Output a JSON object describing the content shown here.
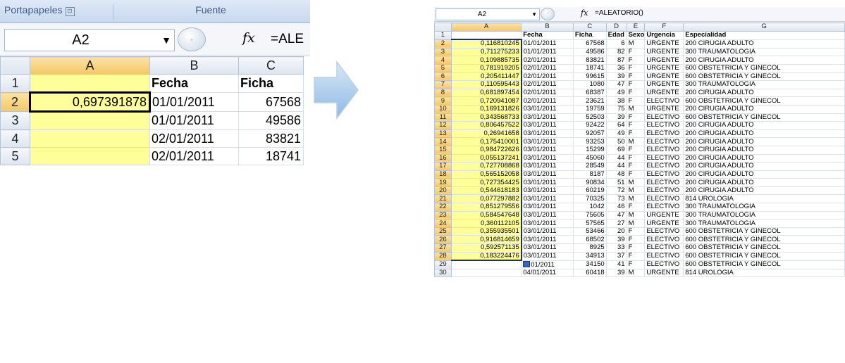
{
  "left": {
    "ribbon": {
      "group1": "Portapapeles",
      "group2": "Fuente",
      "launcher": "⊡"
    },
    "name_box": "A2",
    "formula_display": "=ALE",
    "fx": "fx",
    "columns": [
      "A",
      "B",
      "C"
    ],
    "rows": [
      {
        "num": "1",
        "a": "",
        "b": "Fecha",
        "c": "Ficha"
      },
      {
        "num": "2",
        "a": "0,697391878",
        "b": "01/01/2011",
        "c": "67568"
      },
      {
        "num": "3",
        "a": "",
        "b": "01/01/2011",
        "c": "49586"
      },
      {
        "num": "4",
        "a": "",
        "b": "02/01/2011",
        "c": "83821"
      },
      {
        "num": "5",
        "a": "",
        "b": "02/01/2011",
        "c": "18741"
      }
    ]
  },
  "right": {
    "name_box": "A2",
    "formula": "=ALEATORIO()",
    "fx": "fx",
    "columns": [
      "A",
      "B",
      "C",
      "D",
      "E",
      "F",
      "G"
    ],
    "header_row": {
      "num": "1",
      "a": "",
      "fecha": "Fecha",
      "ficha": "Ficha",
      "edad": "Edad",
      "sexo": "Sexo",
      "urgencia": "Urgencia",
      "especialidad": "Especialidad"
    },
    "rows": [
      {
        "num": "2",
        "a": "0,116810245",
        "fecha": "01/01/2011",
        "ficha": "67568",
        "edad": "6",
        "sexo": "M",
        "urgencia": "URGENTE",
        "especialidad": "200 CIRUGIA ADULTO"
      },
      {
        "num": "3",
        "a": "0,711275233",
        "fecha": "01/01/2011",
        "ficha": "49586",
        "edad": "82",
        "sexo": "F",
        "urgencia": "URGENTE",
        "especialidad": "300 TRAUMATOLOGIA"
      },
      {
        "num": "4",
        "a": "0,109885735",
        "fecha": "02/01/2011",
        "ficha": "83821",
        "edad": "87",
        "sexo": "F",
        "urgencia": "URGENTE",
        "especialidad": "200 CIRUGIA ADULTO"
      },
      {
        "num": "5",
        "a": "0,781919205",
        "fecha": "02/01/2011",
        "ficha": "18741",
        "edad": "36",
        "sexo": "F",
        "urgencia": "URGENTE",
        "especialidad": "600 OBSTETRICIA Y GINECOL"
      },
      {
        "num": "6",
        "a": "0,205411447",
        "fecha": "02/01/2011",
        "ficha": "99615",
        "edad": "39",
        "sexo": "F",
        "urgencia": "URGENTE",
        "especialidad": "600 OBSTETRICIA Y GINECOL"
      },
      {
        "num": "7",
        "a": "0,110595443",
        "fecha": "02/01/2011",
        "ficha": "1080",
        "edad": "47",
        "sexo": "F",
        "urgencia": "URGENTE",
        "especialidad": "300 TRAUMATOLOGIA"
      },
      {
        "num": "8",
        "a": "0,681897454",
        "fecha": "02/01/2011",
        "ficha": "68387",
        "edad": "49",
        "sexo": "F",
        "urgencia": "URGENTE",
        "especialidad": "200 CIRUGIA ADULTO"
      },
      {
        "num": "9",
        "a": "0,720941087",
        "fecha": "02/01/2011",
        "ficha": "23621",
        "edad": "38",
        "sexo": "F",
        "urgencia": "ELECTIVO",
        "especialidad": "600 OBSTETRICIA Y GINECOL"
      },
      {
        "num": "10",
        "a": "0,169131826",
        "fecha": "03/01/2011",
        "ficha": "19759",
        "edad": "75",
        "sexo": "M",
        "urgencia": "URGENTE",
        "especialidad": "200 CIRUGIA ADULTO"
      },
      {
        "num": "11",
        "a": "0,343568733",
        "fecha": "03/01/2011",
        "ficha": "52503",
        "edad": "39",
        "sexo": "F",
        "urgencia": "ELECTIVO",
        "especialidad": "600 OBSTETRICIA Y GINECOL"
      },
      {
        "num": "12",
        "a": "0,806457522",
        "fecha": "03/01/2011",
        "ficha": "92422",
        "edad": "64",
        "sexo": "F",
        "urgencia": "ELECTIVO",
        "especialidad": "200 CIRUGIA ADULTO"
      },
      {
        "num": "13",
        "a": "0,26941658",
        "fecha": "03/01/2011",
        "ficha": "92057",
        "edad": "49",
        "sexo": "F",
        "urgencia": "ELECTIVO",
        "especialidad": "200 CIRUGIA ADULTO"
      },
      {
        "num": "14",
        "a": "0,175410001",
        "fecha": "03/01/2011",
        "ficha": "93253",
        "edad": "50",
        "sexo": "M",
        "urgencia": "ELECTIVO",
        "especialidad": "200 CIRUGIA ADULTO"
      },
      {
        "num": "15",
        "a": "0,984722626",
        "fecha": "03/01/2011",
        "ficha": "15299",
        "edad": "69",
        "sexo": "F",
        "urgencia": "ELECTIVO",
        "especialidad": "200 CIRUGIA ADULTO"
      },
      {
        "num": "16",
        "a": "0,055137241",
        "fecha": "03/01/2011",
        "ficha": "45060",
        "edad": "44",
        "sexo": "F",
        "urgencia": "ELECTIVO",
        "especialidad": "200 CIRUGIA ADULTO"
      },
      {
        "num": "17",
        "a": "0,727708868",
        "fecha": "03/01/2011",
        "ficha": "28549",
        "edad": "44",
        "sexo": "F",
        "urgencia": "ELECTIVO",
        "especialidad": "200 CIRUGIA ADULTO"
      },
      {
        "num": "18",
        "a": "0,565152058",
        "fecha": "03/01/2011",
        "ficha": "8187",
        "edad": "48",
        "sexo": "F",
        "urgencia": "ELECTIVO",
        "especialidad": "200 CIRUGIA ADULTO"
      },
      {
        "num": "19",
        "a": "0,727354425",
        "fecha": "03/01/2011",
        "ficha": "90834",
        "edad": "51",
        "sexo": "M",
        "urgencia": "ELECTIVO",
        "especialidad": "200 CIRUGIA ADULTO"
      },
      {
        "num": "20",
        "a": "0,544618183",
        "fecha": "03/01/2011",
        "ficha": "60219",
        "edad": "72",
        "sexo": "M",
        "urgencia": "ELECTIVO",
        "especialidad": "200 CIRUGIA ADULTO"
      },
      {
        "num": "21",
        "a": "0,077297882",
        "fecha": "03/01/2011",
        "ficha": "70325",
        "edad": "73",
        "sexo": "M",
        "urgencia": "ELECTIVO",
        "especialidad": "814 UROLOGIA"
      },
      {
        "num": "22",
        "a": "0,851279556",
        "fecha": "03/01/2011",
        "ficha": "1042",
        "edad": "46",
        "sexo": "F",
        "urgencia": "ELECTIVO",
        "especialidad": "300 TRAUMATOLOGIA"
      },
      {
        "num": "23",
        "a": "0,584547648",
        "fecha": "03/01/2011",
        "ficha": "75605",
        "edad": "47",
        "sexo": "M",
        "urgencia": "URGENTE",
        "especialidad": "300 TRAUMATOLOGIA"
      },
      {
        "num": "24",
        "a": "0,360112105",
        "fecha": "03/01/2011",
        "ficha": "57565",
        "edad": "27",
        "sexo": "M",
        "urgencia": "URGENTE",
        "especialidad": "300 TRAUMATOLOGIA"
      },
      {
        "num": "25",
        "a": "0,355935501",
        "fecha": "03/01/2011",
        "ficha": "53466",
        "edad": "20",
        "sexo": "F",
        "urgencia": "ELECTIVO",
        "especialidad": "600 OBSTETRICIA Y GINECOL"
      },
      {
        "num": "26",
        "a": "0,916814659",
        "fecha": "03/01/2011",
        "ficha": "68502",
        "edad": "39",
        "sexo": "F",
        "urgencia": "ELECTIVO",
        "especialidad": "600 OBSTETRICIA Y GINECOL"
      },
      {
        "num": "27",
        "a": "0,592571135",
        "fecha": "03/01/2011",
        "ficha": "8925",
        "edad": "33",
        "sexo": "F",
        "urgencia": "ELECTIVO",
        "especialidad": "600 OBSTETRICIA Y GINECOL"
      },
      {
        "num": "28",
        "a": "0,183224476",
        "fecha": "03/01/2011",
        "ficha": "34913",
        "edad": "37",
        "sexo": "F",
        "urgencia": "ELECTIVO",
        "especialidad": "600 OBSTETRICIA Y GINECOL"
      },
      {
        "num": "29",
        "a": "",
        "fecha": "01/2011",
        "ficha": "34150",
        "edad": "41",
        "sexo": "F",
        "urgencia": "ELECTIVO",
        "especialidad": "600 OBSTETRICIA Y GINECOL"
      },
      {
        "num": "30",
        "a": "",
        "fecha": "04/01/2011",
        "ficha": "60418",
        "edad": "39",
        "sexo": "M",
        "urgencia": "URGENTE",
        "especialidad": "814 UROLOGIA"
      }
    ]
  },
  "colors": {
    "selection_yellow": "#ffff99",
    "header_selected": "#f5c767",
    "arrow_blue": "#9cc4ea"
  }
}
